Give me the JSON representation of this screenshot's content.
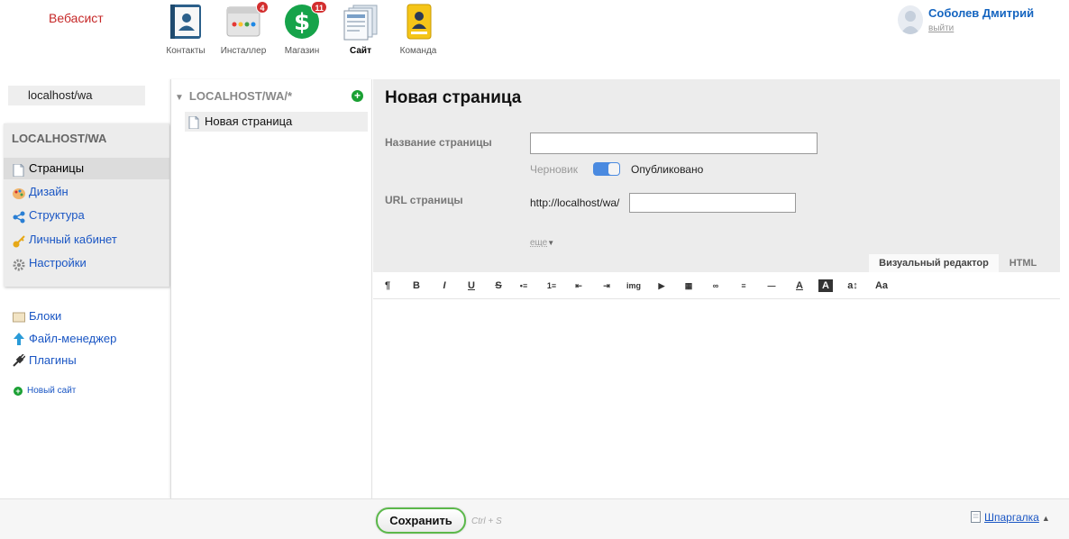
{
  "header": {
    "brand": "Вебасист",
    "apps": [
      {
        "label": "Контакты",
        "icon": "contacts-icon"
      },
      {
        "label": "Инсталлер",
        "icon": "installer-icon",
        "badge": "4"
      },
      {
        "label": "Магазин",
        "icon": "shop-icon",
        "badge": "11"
      },
      {
        "label": "Сайт",
        "icon": "site-icon",
        "active": true
      },
      {
        "label": "Команда",
        "icon": "team-icon"
      }
    ],
    "user": {
      "name": "Соболев Дмитрий",
      "logout": "выйти"
    }
  },
  "sidebar": {
    "domain": "localhost/wa",
    "site_title": "LOCALHOST/WA",
    "items": [
      {
        "label": "Страницы",
        "icon": "pages-icon",
        "selected": true
      },
      {
        "label": "Дизайн",
        "icon": "palette-icon"
      },
      {
        "label": "Структура",
        "icon": "structure-icon"
      },
      {
        "label": "Личный кабинет",
        "icon": "key-icon"
      },
      {
        "label": "Настройки",
        "icon": "gear-icon"
      }
    ],
    "extra": [
      {
        "label": "Блоки",
        "icon": "blocks-icon"
      },
      {
        "label": "Файл-менеджер",
        "icon": "upload-icon"
      },
      {
        "label": "Плагины",
        "icon": "plug-icon"
      }
    ],
    "new_site": "Новый сайт"
  },
  "tree": {
    "head": "LOCALHOST/WA/*",
    "items": [
      {
        "label": "Новая страница"
      }
    ]
  },
  "editor": {
    "title": "Новая страница",
    "name_label": "Название страницы",
    "name_value": "",
    "draft": "Черновик",
    "published": "Опубликовано",
    "url_label": "URL страницы",
    "url_prefix": "http://localhost/wa/",
    "url_value": "",
    "more": "еще",
    "tabs": {
      "visual": "Визуальный редактор",
      "html": "HTML"
    },
    "toolbar": [
      "¶",
      "B",
      "I",
      "U",
      "S",
      "•≡",
      "1≡",
      "⇤",
      "⇥",
      "img",
      "▶",
      "▦",
      "∞",
      "≡",
      "—",
      "A",
      "A",
      "a↕",
      "Aa"
    ]
  },
  "footer": {
    "save": "Сохранить",
    "shortcut": "Ctrl + S",
    "cheatsheet": "Шпаргалка"
  },
  "colors": {
    "brand": "#c62828",
    "link": "#1a56c4",
    "accent_green": "#5bb84a",
    "toggle": "#4a8ae0"
  }
}
